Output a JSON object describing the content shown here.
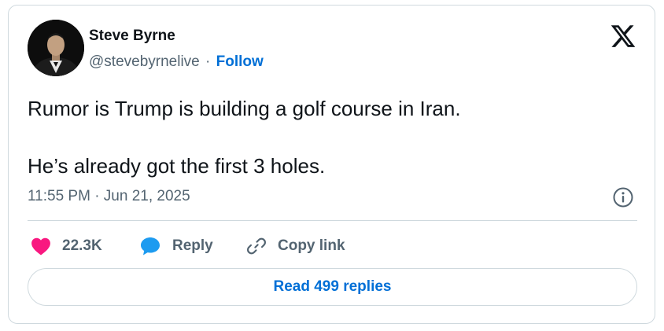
{
  "author": {
    "name": "Steve Byrne",
    "handle": "@stevebyrnelive",
    "separator": "·",
    "follow_label": "Follow"
  },
  "tweet": {
    "lines": [
      "Rumor is Trump is building a golf course in Iran.",
      "He’s already got the first 3 holes."
    ],
    "timestamp": "11:55 PM · Jun 21, 2025"
  },
  "actions": {
    "like_count": "22.3K",
    "reply_label": "Reply",
    "copy_label": "Copy link"
  },
  "read_replies_label": "Read 499 replies",
  "icons": {
    "brand": "x-logo-icon",
    "info": "info-icon",
    "like": "heart-icon",
    "reply": "reply-bubble-icon",
    "copy": "link-icon"
  },
  "colors": {
    "link_blue": "#006fd6",
    "heart_pink": "#f91880",
    "reply_blue": "#1d9bf0",
    "muted_text": "#536471",
    "border": "#cfd9de"
  }
}
